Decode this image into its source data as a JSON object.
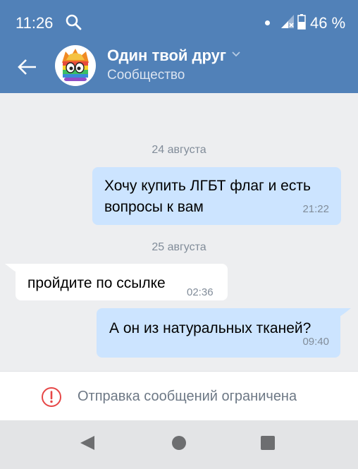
{
  "status_bar": {
    "time": "11:26",
    "battery": "46 %",
    "icons": [
      "search-icon",
      "notification-dot-icon",
      "signal-icon",
      "battery-icon"
    ]
  },
  "header": {
    "back_icon": "arrow-left-icon",
    "title": "Один твой друг",
    "title_icon": "chevron-down-icon",
    "subtitle": "Сообщество",
    "avatar_icon": "rainbow-character-avatar"
  },
  "chat": {
    "dates": [
      "24 августа",
      "25 августа"
    ],
    "messages": [
      {
        "direction": "outgoing",
        "lines": [
          "Хочу купить ЛГБТ флаг и есть",
          "вопросы к вам"
        ],
        "time": "21:22"
      },
      {
        "direction": "incoming",
        "lines": [
          "пройдите по ссылке"
        ],
        "time": "02:36"
      },
      {
        "direction": "outgoing",
        "lines": [
          "А он из натуральных тканей?"
        ],
        "time": "09:40"
      }
    ]
  },
  "restriction": {
    "icon": "warning-circle-icon",
    "text": "Отправка сообщений ограничена"
  },
  "nav_bar": {
    "icons": [
      "nav-back-icon",
      "nav-home-icon",
      "nav-recents-icon"
    ]
  },
  "colors": {
    "header_bg": "#5181b8",
    "outgoing_bubble": "#cce4ff",
    "incoming_bubble": "#ffffff",
    "chat_bg": "#edeef0",
    "warning": "#e64646",
    "nav_bg": "#e3e4e6"
  }
}
